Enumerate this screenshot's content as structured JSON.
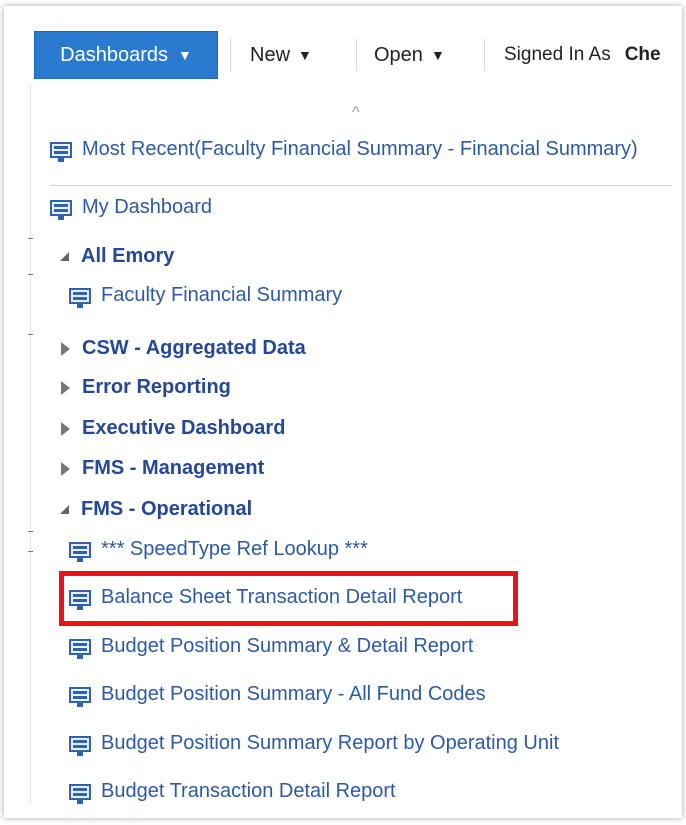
{
  "toolbar": {
    "dashboards_label": "Dashboards",
    "new_label": "New",
    "open_label": "Open",
    "signed_in_label": "Signed In As",
    "signed_in_user": "Che",
    "dropdown_arrow": "▼"
  },
  "menu": {
    "scroll_up_icon": "^",
    "most_recent": "Most Recent(Faculty Financial Summary - Financial Summary)",
    "my_dashboard": "My Dashboard",
    "groups": [
      {
        "label": "All Emory",
        "expanded": true,
        "items": [
          "Faculty Financial Summary"
        ]
      },
      {
        "label": "CSW - Aggregated Data",
        "expanded": false,
        "items": []
      },
      {
        "label": "Error Reporting",
        "expanded": false,
        "items": []
      },
      {
        "label": "Executive Dashboard",
        "expanded": false,
        "items": []
      },
      {
        "label": "FMS - Management",
        "expanded": false,
        "items": []
      },
      {
        "label": "FMS - Operational",
        "expanded": true,
        "items": [
          "*** SpeedType Ref Lookup ***",
          "Balance Sheet Transaction Detail Report",
          "Budget Position Summary & Detail Report",
          "Budget Position Summary - All Fund Codes",
          "Budget Position Summary Report by Operating Unit",
          "Budget Transaction Detail Report"
        ]
      }
    ]
  },
  "highlighted_item": "Balance Sheet Transaction Detail Report",
  "colors": {
    "primary_button": "#2a7bd0",
    "link_text": "#2c5aa6",
    "folder_text": "#24479a",
    "highlight_border": "#e8141b"
  }
}
